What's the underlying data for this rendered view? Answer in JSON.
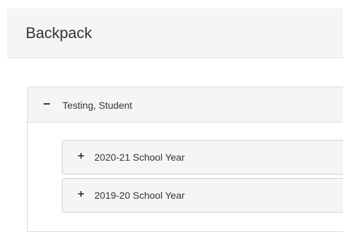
{
  "page": {
    "title": "Backpack"
  },
  "student_panel": {
    "toggle_symbol": "−",
    "name": "Testing, Student",
    "years": [
      {
        "toggle_symbol": "+",
        "label": "2020-21 School Year"
      },
      {
        "toggle_symbol": "+",
        "label": "2019-20 School Year"
      }
    ]
  }
}
